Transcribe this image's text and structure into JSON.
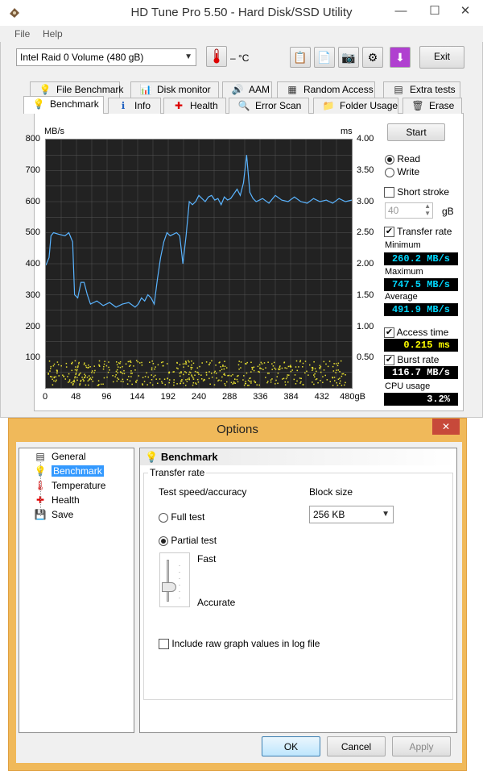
{
  "window": {
    "title": "HD Tune Pro 5.50 - Hard Disk/SSD Utility",
    "minimize": "—",
    "maximize": "☐",
    "close": "✕"
  },
  "menu": {
    "file": "File",
    "help": "Help"
  },
  "toolbar": {
    "drive": "Intel   Raid 0 Volume (480 gB)",
    "temperature": "– °C",
    "exit": "Exit"
  },
  "tabs_row1": [
    {
      "label": "File Benchmark",
      "icon": "file-benchmark-icon"
    },
    {
      "label": "Disk monitor",
      "icon": "disk-monitor-icon"
    },
    {
      "label": "AAM",
      "icon": "speaker-icon"
    },
    {
      "label": "Random Access",
      "icon": "random-access-icon"
    },
    {
      "label": "Extra tests",
      "icon": "extra-tests-icon"
    }
  ],
  "tabs_row2": [
    {
      "label": "Benchmark",
      "icon": "benchmark-icon"
    },
    {
      "label": "Info",
      "icon": "info-icon"
    },
    {
      "label": "Health",
      "icon": "health-icon"
    },
    {
      "label": "Error Scan",
      "icon": "magnifier-icon"
    },
    {
      "label": "Folder Usage",
      "icon": "folder-icon"
    },
    {
      "label": "Erase",
      "icon": "trash-icon"
    }
  ],
  "chart_data": {
    "type": "line",
    "y_unit": "MB/s",
    "y2_unit": "ms",
    "y_ticks": [
      "800",
      "700",
      "600",
      "500",
      "400",
      "300",
      "200",
      "100"
    ],
    "y2_ticks": [
      "4.00",
      "3.50",
      "3.00",
      "2.50",
      "2.00",
      "1.50",
      "1.00",
      "0.50"
    ],
    "x_ticks": [
      "0",
      "48",
      "96",
      "144",
      "192",
      "240",
      "288",
      "336",
      "384",
      "432",
      "480gB"
    ],
    "ylim": [
      0,
      800
    ],
    "y2lim": [
      0,
      4.0
    ],
    "xlim": [
      0,
      480
    ],
    "grid": true,
    "series": [
      {
        "color": "#5ab4ff",
        "x": [
          0,
          5,
          8,
          12,
          20,
          30,
          36,
          42,
          45,
          50,
          55,
          60,
          65,
          70,
          80,
          90,
          100,
          110,
          120,
          130,
          140,
          145,
          150,
          155,
          160,
          165,
          170,
          175,
          180,
          185,
          190,
          195,
          200,
          205,
          210,
          215,
          220,
          225,
          230,
          235,
          240,
          245,
          250,
          255,
          260,
          265,
          270,
          275,
          280,
          285,
          290,
          295,
          300,
          305,
          310,
          315,
          320,
          325,
          330,
          340,
          350,
          360,
          370,
          380,
          390,
          400,
          410,
          420,
          430,
          440,
          450,
          460,
          470,
          480
        ],
        "y": [
          395,
          420,
          490,
          500,
          495,
          490,
          500,
          470,
          300,
          290,
          340,
          340,
          300,
          270,
          280,
          265,
          275,
          260,
          270,
          275,
          260,
          270,
          290,
          280,
          300,
          290,
          270,
          350,
          420,
          470,
          500,
          490,
          495,
          500,
          490,
          400,
          490,
          600,
          590,
          600,
          620,
          610,
          600,
          615,
          620,
          605,
          610,
          590,
          615,
          605,
          610,
          625,
          640,
          620,
          660,
          750,
          630,
          610,
          600,
          610,
          595,
          620,
          605,
          600,
          615,
          600,
          595,
          610,
          600,
          605,
          595,
          610,
          600,
          605
        ]
      }
    ],
    "access_time_points": "yellow scatter band between 0.05 and 0.45 ms"
  },
  "sidebar": {
    "start": "Start",
    "read": "Read",
    "write": "Write",
    "short_stroke": "Short stroke",
    "stroke_value": "40",
    "stroke_unit": "gB",
    "transfer_rate": "Transfer rate",
    "minimum_label": "Minimum",
    "minimum_value": "260.2 MB/s",
    "maximum_label": "Maximum",
    "maximum_value": "747.5 MB/s",
    "average_label": "Average",
    "average_value": "491.9 MB/s",
    "access_time": "Access time",
    "access_time_value": "0.215 ms",
    "burst_rate": "Burst rate",
    "burst_rate_value": "116.7 MB/s",
    "cpu_usage": "CPU usage",
    "cpu_usage_value": "3.2%"
  },
  "options": {
    "title": "Options",
    "close": "✕",
    "tree": [
      {
        "label": "General",
        "icon": "general-icon"
      },
      {
        "label": "Benchmark",
        "icon": "benchmark-icon"
      },
      {
        "label": "Temperature",
        "icon": "thermometer-icon"
      },
      {
        "label": "Health",
        "icon": "health-icon"
      },
      {
        "label": "Save",
        "icon": "floppy-icon"
      }
    ],
    "panel_title": "Benchmark",
    "group_title": "Transfer rate",
    "speed_label": "Test speed/accuracy",
    "block_label": "Block size",
    "block_value": "256 KB",
    "full_test": "Full test",
    "partial_test": "Partial test",
    "fast": "Fast",
    "accurate": "Accurate",
    "include_raw": "Include raw graph values in log file",
    "ok": "OK",
    "cancel": "Cancel",
    "apply": "Apply"
  }
}
